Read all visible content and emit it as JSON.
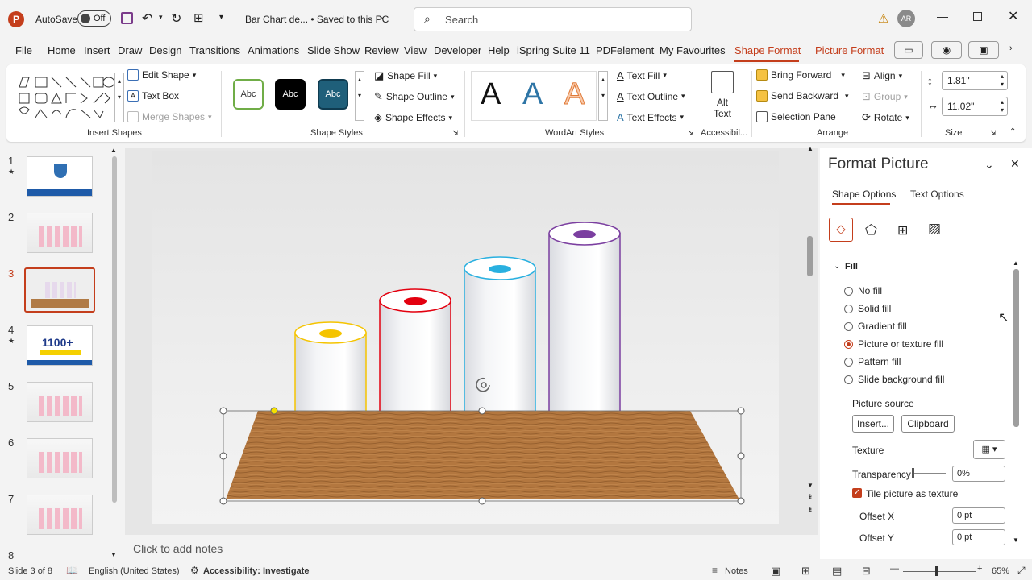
{
  "titlebar": {
    "autosave_label": "AutoSave",
    "autosave_state": "Off",
    "doc_title": "Bar Chart de... • Saved to this PC",
    "search_placeholder": "Search",
    "user_initials": "AR"
  },
  "menu": {
    "tabs": [
      "File",
      "Home",
      "Insert",
      "Draw",
      "Design",
      "Transitions",
      "Animations",
      "Slide Show",
      "Review",
      "View",
      "Developer",
      "Help",
      "iSpring Suite 11",
      "PDFelement",
      "My Favourites",
      "Shape Format",
      "Picture Format"
    ],
    "active": "Shape Format"
  },
  "ribbon": {
    "insert_shapes": {
      "edit_shape": "Edit Shape",
      "text_box": "Text Box",
      "merge_shapes": "Merge Shapes",
      "label": "Insert Shapes"
    },
    "shape_styles": {
      "sample": "Abc",
      "fill": "Shape Fill",
      "outline": "Shape Outline",
      "effects": "Shape Effects",
      "label": "Shape Styles"
    },
    "wordart": {
      "letter": "A",
      "text_fill": "Text Fill",
      "text_outline": "Text Outline",
      "text_effects": "Text Effects",
      "label": "WordArt Styles"
    },
    "accessibility": {
      "alt_text_1": "Alt",
      "alt_text_2": "Text",
      "label": "Accessibil..."
    },
    "arrange": {
      "bring_forward": "Bring Forward",
      "send_backward": "Send Backward",
      "selection_pane": "Selection Pane",
      "align": "Align",
      "group": "Group",
      "rotate": "Rotate",
      "label": "Arrange"
    },
    "size": {
      "height": "1.81\"",
      "width": "11.02\"",
      "label": "Size"
    }
  },
  "slides": {
    "numbers": [
      "1",
      "2",
      "3",
      "4",
      "5",
      "6",
      "7",
      "8"
    ],
    "current": "3",
    "thumb4_text": "1100+"
  },
  "notes_placeholder": "Click to add notes",
  "pane": {
    "title": "Format Picture",
    "tabs": [
      "Shape Options",
      "Text Options"
    ],
    "section": "Fill",
    "fill_options": [
      "No fill",
      "Solid fill",
      "Gradient fill",
      "Picture or texture fill",
      "Pattern fill",
      "Slide background fill"
    ],
    "selected_fill": "Picture or texture fill",
    "picture_source": "Picture source",
    "insert_btn": "Insert...",
    "clipboard_btn": "Clipboard",
    "texture": "Texture",
    "transparency": "Transparency",
    "transparency_value": "0%",
    "tile": "Tile picture as texture",
    "offset_x": "Offset X",
    "offset_x_value": "0 pt",
    "offset_y": "Offset Y",
    "offset_y_value": "0 pt"
  },
  "status": {
    "slide_of": "Slide 3 of 8",
    "language": "English (United States)",
    "accessibility": "Accessibility: Investigate",
    "notes": "Notes",
    "zoom": "65%"
  },
  "colors": {
    "accent": "#c43e1c",
    "yellow": "#f5c400",
    "red": "#e3000f",
    "blue": "#29b0e0",
    "purple": "#7b3fa0"
  }
}
